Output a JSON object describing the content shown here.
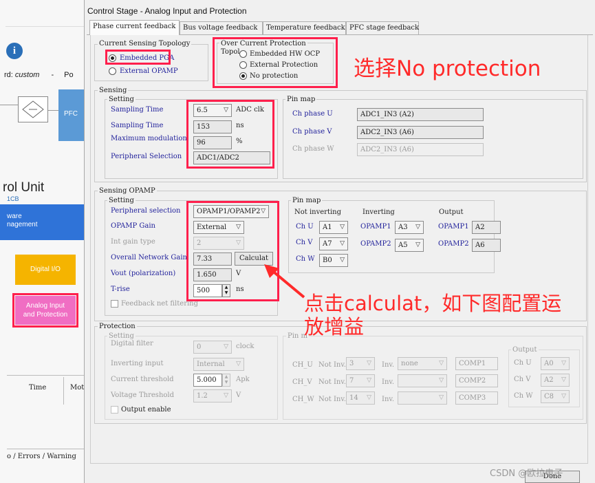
{
  "left_app": {
    "board_label": "rd:",
    "board_value": "custom",
    "dash": "-",
    "po_label": "Po",
    "pfc_label": "PFC",
    "control_unit": "rol Unit",
    "cb_label": "1CB",
    "blue_tile_line1": "ware",
    "blue_tile_line2": "nagement",
    "digital_io": "Digital I/O",
    "analog_input": "Analog Input",
    "and_protection": "and Protection",
    "col_time": "Time",
    "col_mot": "Mot",
    "log_tabs": "o / Errors / Warning"
  },
  "dialog": {
    "title": "Control Stage - Analog Input and Protection",
    "tabs": [
      "Phase current feedback",
      "Bus voltage feedback",
      "Temperature feedback",
      "PFC stage feedback"
    ],
    "done_label": "Done"
  },
  "topology": {
    "group_label": "Current Sensing Topology",
    "opt_embedded": "Embedded PGA",
    "opt_external": "External OPAMP"
  },
  "ocp": {
    "group_label": "Over Current Protection",
    "topol_label": "Topol",
    "opt_hw": "Embedded HW OCP",
    "opt_external": "External Protection",
    "opt_none": "No protection"
  },
  "sensing": {
    "group_label": "Sensing",
    "setting_label": "Setting",
    "sampling_time_label": "Sampling Time",
    "sampling_time_value": "6.5",
    "sampling_time_unit": "ADC clk",
    "sampling_time2_label": "Sampling Time",
    "sampling_time2_value": "153",
    "sampling_time2_unit": "ns",
    "max_mod_label": "Maximum modulation",
    "max_mod_value": "96",
    "max_mod_unit": "%",
    "periph_label": "Peripheral Selection",
    "periph_value": "ADC1/ADC2",
    "pinmap_label": "Pin map",
    "ch_u_label": "Ch phase U",
    "ch_u_value": "ADC1_IN3 (A2)",
    "ch_v_label": "Ch phase V",
    "ch_v_value": "ADC2_IN3 (A6)",
    "ch_w_label": "Ch phase W",
    "ch_w_value": "ADC2_IN3 (A6)"
  },
  "opamp": {
    "group_label": "Sensing OPAMP",
    "setting_label": "Setting",
    "periph_label": "Peripheral selection",
    "periph_value": "OPAMP1/OPAMP2",
    "gain_label": "OPAMP Gain",
    "gain_value": "External",
    "int_gain_label": "Int gain type",
    "int_gain_value": "2",
    "net_gain_label": "Overall Network Gain",
    "net_gain_value": "7.33",
    "calc_label": "Calculat",
    "vout_label": "Vout (polarization)",
    "vout_value": "1.650",
    "vout_unit": "V",
    "trise_label": "T-rise",
    "trise_value": "500",
    "trise_unit": "ns",
    "feedback_label": "Feedback net filtering",
    "pinmap_label": "Pin map",
    "noninv_label": "Not inverting",
    "inv_label": "Inverting",
    "out_label": "Output",
    "ch_u": "Ch U",
    "ch_u_val": "A1",
    "ch_v": "Ch V",
    "ch_v_val": "A7",
    "ch_w": "Ch W",
    "ch_w_val": "B0",
    "opamp1": "OPAMP1",
    "opamp1_inv": "A3",
    "opamp2": "OPAMP2",
    "opamp2_inv": "A5",
    "out_opamp1": "OPAMP1",
    "out_opamp1_val": "A2",
    "out_opamp2": "OPAMP2",
    "out_opamp2_val": "A6"
  },
  "protection": {
    "group_label": "Protection",
    "setting_label": "Setting",
    "digital_filter_label": "Digital filter",
    "digital_filter_value": "0",
    "digital_filter_unit": "clock",
    "inv_input_label": "Inverting input",
    "inv_input_value": "Internal",
    "cur_thr_label": "Current threshold",
    "cur_thr_value": "5.000",
    "cur_thr_unit": "Apk",
    "volt_thr_label": "Voltage Threshold",
    "volt_thr_value": "1.2",
    "volt_thr_unit": "V",
    "output_enable_label": "Output enable",
    "pinmap_label": "Pin m",
    "rows": [
      {
        "ch": "CH_U",
        "noninv": "Not Inv.",
        "noninv_val": "3",
        "inv": "Inv.",
        "inv_val": "none",
        "comp": "COMP1"
      },
      {
        "ch": "CH_V",
        "noninv": "Not Inv.",
        "noninv_val": "7",
        "inv": "Inv.",
        "inv_val": "",
        "comp": "COMP2"
      },
      {
        "ch": "CH_W",
        "noninv": "Not Inv.",
        "noninv_val": "14",
        "inv": "Inv.",
        "inv_val": "",
        "comp": "COMP3"
      }
    ],
    "out_label": "Output",
    "out_rows": [
      {
        "ch": "Ch U",
        "val": "A0"
      },
      {
        "ch": "Ch V",
        "val": "A2"
      },
      {
        "ch": "Ch W",
        "val": "C8"
      }
    ]
  },
  "annotations": {
    "select_no_protection": "选择No protection",
    "click_calculat_line1": "点击calculat，如下图配置运",
    "click_calculat_line2": "放增益"
  },
  "watermark": "CSDN @欧拉电子",
  "colors": {
    "annotation_red": "#ff2a2a",
    "highlight_box": "#ff1f4c",
    "label_blue": "#1f1f9a",
    "pink_tile": "#f06ec3",
    "orange_tile": "#f5b400",
    "blue_tile": "#5b9ad6"
  }
}
